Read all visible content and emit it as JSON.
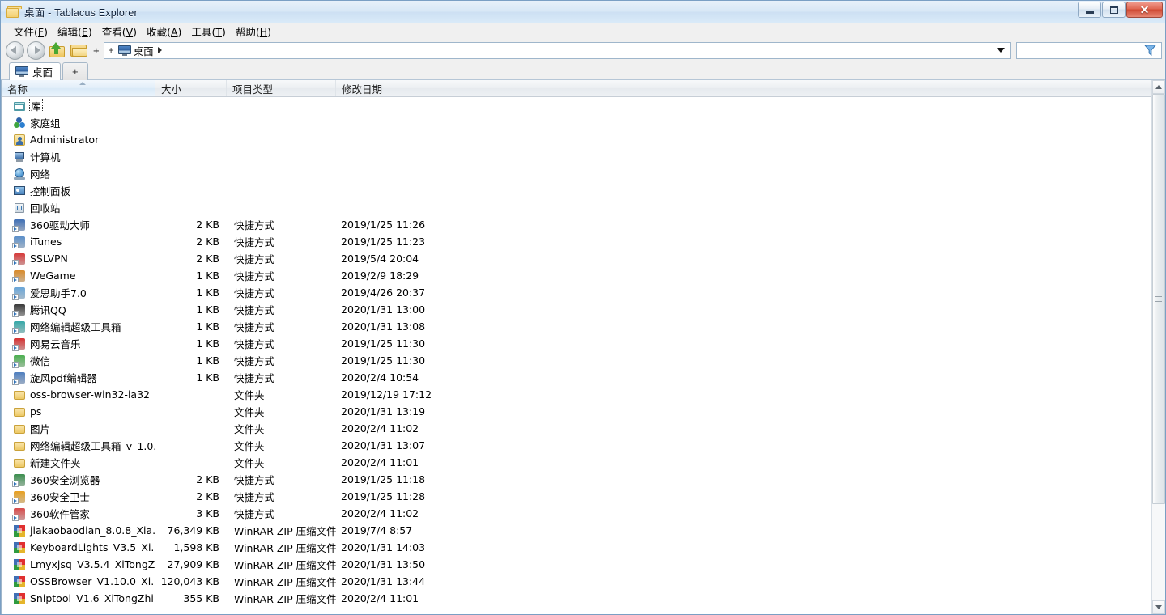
{
  "window": {
    "title": "桌面 - Tablacus Explorer",
    "icon": "folder-icon",
    "minimize_label": "",
    "maximize_label": "",
    "close_label": "✕"
  },
  "menubar": {
    "items": [
      {
        "label": "文件(F)",
        "text": "文件",
        "mnemonic": "F"
      },
      {
        "label": "编辑(E)",
        "text": "编辑",
        "mnemonic": "E"
      },
      {
        "label": "查看(V)",
        "text": "查看",
        "mnemonic": "V"
      },
      {
        "label": "收藏(A)",
        "text": "收藏",
        "mnemonic": "A"
      },
      {
        "label": "工具(T)",
        "text": "工具",
        "mnemonic": "T"
      },
      {
        "label": "帮助(H)",
        "text": "帮助",
        "mnemonic": "H"
      }
    ]
  },
  "toolbar": {
    "back_icon": "back-arrow-icon",
    "forward_icon": "forward-arrow-icon",
    "up_icon": "up-folder-icon",
    "folder_icon": "folder-icon",
    "plus_label": "+",
    "breadcrumb": {
      "plus_label": "+",
      "icon": "desktop-monitor-icon",
      "label": "桌面",
      "caret": "▶"
    },
    "search": {
      "value": "",
      "placeholder": "",
      "icon": "filter-funnel-icon"
    }
  },
  "tabs": {
    "items": [
      {
        "label": "桌面",
        "icon": "desktop-monitor-icon",
        "active": true
      }
    ],
    "new_tab_label": "+"
  },
  "columns": [
    {
      "key": "name",
      "label": "名称",
      "sorted": true,
      "sort_direction": "asc"
    },
    {
      "key": "size",
      "label": "大小",
      "sorted": false
    },
    {
      "key": "type",
      "label": "项目类型",
      "sorted": false
    },
    {
      "key": "date",
      "label": "修改日期",
      "sorted": false
    }
  ],
  "rows": [
    {
      "name": "库",
      "size": "",
      "type": "",
      "date": "",
      "icon": "library-icon",
      "focused": true
    },
    {
      "name": "家庭组",
      "size": "",
      "type": "",
      "date": "",
      "icon": "homegroup-icon"
    },
    {
      "name": "Administrator",
      "size": "",
      "type": "",
      "date": "",
      "icon": "user-folder-icon"
    },
    {
      "name": "计算机",
      "size": "",
      "type": "",
      "date": "",
      "icon": "computer-icon"
    },
    {
      "name": "网络",
      "size": "",
      "type": "",
      "date": "",
      "icon": "network-icon"
    },
    {
      "name": "控制面板",
      "size": "",
      "type": "",
      "date": "",
      "icon": "control-panel-icon"
    },
    {
      "name": "回收站",
      "size": "",
      "type": "",
      "date": "",
      "icon": "recycle-bin-icon"
    },
    {
      "name": "360驱动大师",
      "size": "2 KB",
      "type": "快捷方式",
      "date": "2019/1/25 11:26",
      "icon": "shortcut-icon",
      "color": "#3f6fb5"
    },
    {
      "name": "iTunes",
      "size": "2 KB",
      "type": "快捷方式",
      "date": "2019/1/25 11:23",
      "icon": "shortcut-icon",
      "color": "#5b8fc9"
    },
    {
      "name": "SSLVPN",
      "size": "2 KB",
      "type": "快捷方式",
      "date": "2019/5/4 20:04",
      "icon": "shortcut-icon",
      "color": "#d73b3b"
    },
    {
      "name": "WeGame",
      "size": "1 KB",
      "type": "快捷方式",
      "date": "2019/2/9 18:29",
      "icon": "shortcut-icon",
      "color": "#d98b2b"
    },
    {
      "name": "爱思助手7.0",
      "size": "1 KB",
      "type": "快捷方式",
      "date": "2019/4/26 20:37",
      "icon": "shortcut-icon",
      "color": "#6aa6d8"
    },
    {
      "name": "腾讯QQ",
      "size": "1 KB",
      "type": "快捷方式",
      "date": "2020/1/31 13:00",
      "icon": "shortcut-icon",
      "color": "#3a3a3a"
    },
    {
      "name": "网络编辑超级工具箱",
      "size": "1 KB",
      "type": "快捷方式",
      "date": "2020/1/31 13:08",
      "icon": "shortcut-icon",
      "color": "#36a8a8"
    },
    {
      "name": "网易云音乐",
      "size": "1 KB",
      "type": "快捷方式",
      "date": "2019/1/25 11:30",
      "icon": "shortcut-icon",
      "color": "#d63030"
    },
    {
      "name": "微信",
      "size": "1 KB",
      "type": "快捷方式",
      "date": "2019/1/25 11:30",
      "icon": "shortcut-icon",
      "color": "#4caf50"
    },
    {
      "name": "旋风pdf编辑器",
      "size": "1 KB",
      "type": "快捷方式",
      "date": "2020/2/4 10:54",
      "icon": "shortcut-icon",
      "color": "#4f7fbf"
    },
    {
      "name": "oss-browser-win32-ia32",
      "size": "",
      "type": "文件夹",
      "date": "2019/12/19 17:12",
      "icon": "folder-icon"
    },
    {
      "name": "ps",
      "size": "",
      "type": "文件夹",
      "date": "2020/1/31 13:19",
      "icon": "folder-icon"
    },
    {
      "name": "图片",
      "size": "",
      "type": "文件夹",
      "date": "2020/2/4 11:02",
      "icon": "folder-icon"
    },
    {
      "name": "网络编辑超级工具箱_v_1.0...",
      "size": "",
      "type": "文件夹",
      "date": "2020/1/31 13:07",
      "icon": "folder-icon"
    },
    {
      "name": "新建文件夹",
      "size": "",
      "type": "文件夹",
      "date": "2020/2/4 11:01",
      "icon": "folder-icon"
    },
    {
      "name": "360安全浏览器",
      "size": "2 KB",
      "type": "快捷方式",
      "date": "2019/1/25 11:18",
      "icon": "shortcut-icon",
      "color": "#3c8f4f"
    },
    {
      "name": "360安全卫士",
      "size": "2 KB",
      "type": "快捷方式",
      "date": "2019/1/25 11:28",
      "icon": "shortcut-icon",
      "color": "#e8a020"
    },
    {
      "name": "360软件管家",
      "size": "3 KB",
      "type": "快捷方式",
      "date": "2020/2/4 11:02",
      "icon": "shortcut-icon",
      "color": "#d84a4a"
    },
    {
      "name": "jiakaobaodian_8.0.8_Xia...",
      "size": "76,349 KB",
      "type": "WinRAR ZIP 压缩文件",
      "date": "2019/7/4 8:57",
      "icon": "winrar-zip-icon"
    },
    {
      "name": "KeyboardLights_V3.5_Xi...",
      "size": "1,598 KB",
      "type": "WinRAR ZIP 压缩文件",
      "date": "2020/1/31 14:03",
      "icon": "winrar-zip-icon"
    },
    {
      "name": "Lmyxjsq_V3.5.4_XiTongZ...",
      "size": "27,909 KB",
      "type": "WinRAR ZIP 压缩文件",
      "date": "2020/1/31 13:50",
      "icon": "winrar-zip-icon"
    },
    {
      "name": "OSSBrowser_V1.10.0_Xi...",
      "size": "120,043 KB",
      "type": "WinRAR ZIP 压缩文件",
      "date": "2020/1/31 13:44",
      "icon": "winrar-zip-icon"
    },
    {
      "name": "Sniptool_V1.6_XiTongZhi",
      "size": "355 KB",
      "type": "WinRAR ZIP 压缩文件",
      "date": "2020/2/4 11:01",
      "icon": "winrar-zip-icon"
    }
  ],
  "scrollbar": {
    "up_arrow": "▲",
    "down_arrow": "▼",
    "thumb_top_pct": 0,
    "thumb_height_pct": 81
  },
  "colors": {
    "title_bar": "#d7e7f6",
    "close_button": "#cf4a34",
    "sorted_column": "#e2eef9",
    "window_frame": "#7a9fc4"
  }
}
